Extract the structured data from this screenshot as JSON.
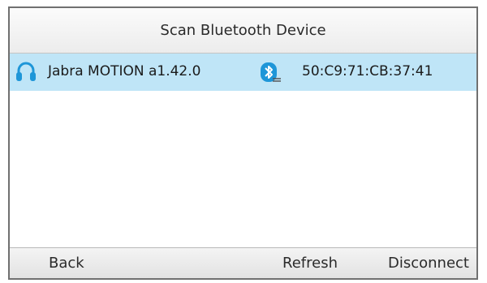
{
  "screen": {
    "title": "Scan Bluetooth Device"
  },
  "devices": [
    {
      "icon": "headset-icon",
      "name": "Jabra MOTION a1.42.0",
      "status_icon": "bluetooth-connected-icon",
      "mac": "50:C9:71:CB:37:41"
    }
  ],
  "softkeys": {
    "back_label": "Back",
    "refresh_label": "Refresh",
    "disconnect_label": "Disconnect"
  },
  "colors": {
    "selected_row": "#bfe5f7",
    "icon_blue": "#1e96d8"
  }
}
